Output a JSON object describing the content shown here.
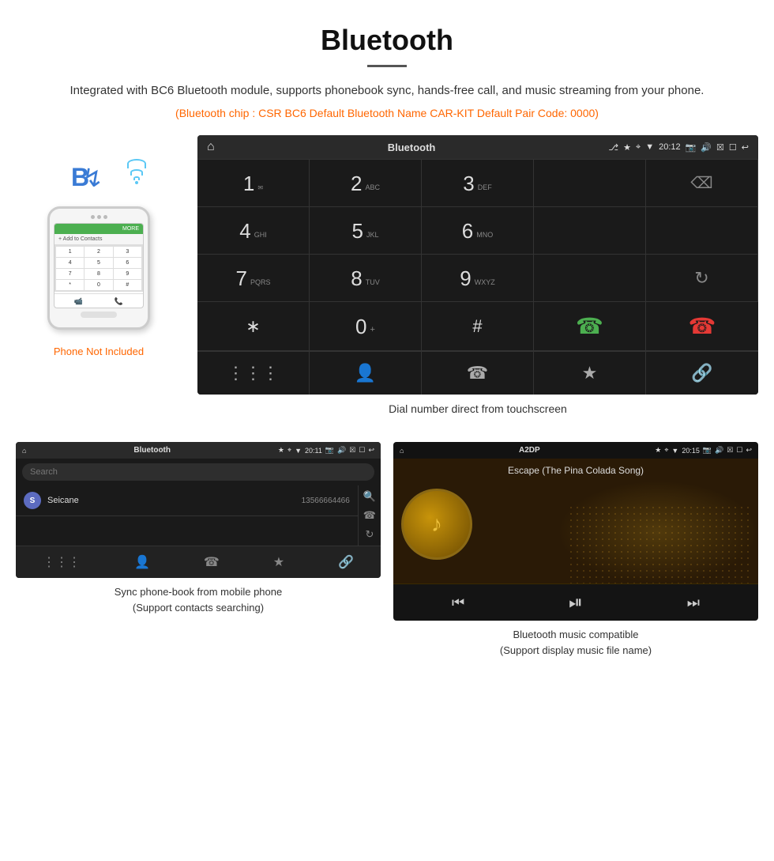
{
  "header": {
    "title": "Bluetooth",
    "subtitle": "Integrated with BC6 Bluetooth module, supports phonebook sync, hands-free call, and music streaming from your phone.",
    "specs": "(Bluetooth chip : CSR BC6    Default Bluetooth Name CAR-KIT    Default Pair Code: 0000)"
  },
  "phone_label": "Phone Not Included",
  "bt_screen": {
    "statusbar": {
      "title": "Bluetooth",
      "time": "20:12"
    },
    "dial": {
      "keys": [
        {
          "num": "1",
          "letters": ""
        },
        {
          "num": "2",
          "letters": "ABC"
        },
        {
          "num": "3",
          "letters": "DEF"
        },
        {
          "num": "",
          "letters": ""
        },
        {
          "num": "",
          "letters": ""
        },
        {
          "num": "4",
          "letters": "GHI"
        },
        {
          "num": "5",
          "letters": "JKL"
        },
        {
          "num": "6",
          "letters": "MNO"
        },
        {
          "num": "",
          "letters": ""
        },
        {
          "num": "",
          "letters": ""
        },
        {
          "num": "7",
          "letters": "PQRS"
        },
        {
          "num": "8",
          "letters": "TUV"
        },
        {
          "num": "9",
          "letters": "WXYZ"
        },
        {
          "num": "",
          "letters": ""
        },
        {
          "num": "",
          "letters": ""
        },
        {
          "num": "*",
          "letters": ""
        },
        {
          "num": "0",
          "letters": "+"
        },
        {
          "num": "#",
          "letters": ""
        },
        {
          "num": "",
          "letters": ""
        },
        {
          "num": "",
          "letters": ""
        }
      ]
    },
    "caption": "Dial number direct from touchscreen"
  },
  "phonebook_screen": {
    "statusbar_title": "Bluetooth",
    "time": "20:11",
    "search_placeholder": "Search",
    "contact": {
      "initial": "S",
      "name": "Seicane",
      "phone": "13566664466"
    }
  },
  "music_screen": {
    "statusbar_title": "A2DP",
    "time": "20:15",
    "song_title": "Escape (The Pina Colada Song)"
  },
  "lower_captions": {
    "phonebook": "Sync phone-book from mobile phone\n(Support contacts searching)",
    "music": "Bluetooth music compatible\n(Support display music file name)"
  }
}
